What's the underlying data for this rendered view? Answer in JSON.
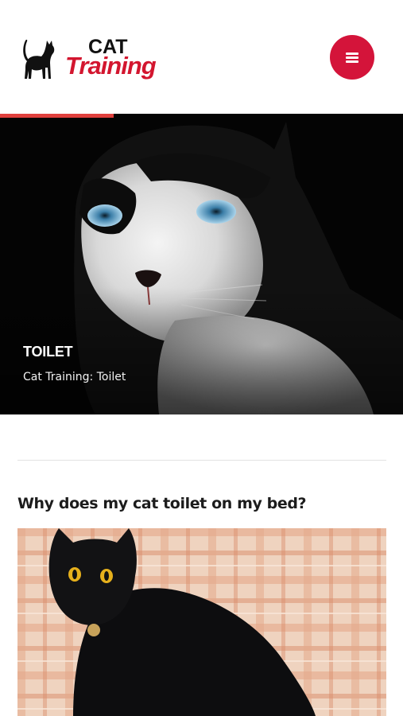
{
  "header": {
    "logo_word_top": "CAT",
    "logo_word_bottom": "Training",
    "menu_icon": "hamburger-menu-icon",
    "brand_color": "#d4143a"
  },
  "hero": {
    "title": "TOILET",
    "subtitle": "Cat Training: Toilet",
    "progress_color": "#e0403d",
    "image": "black-and-white-cat-closeup-photo"
  },
  "article": {
    "title": "Why does my cat toilet on my bed?",
    "image": "black-cat-on-plaid-blanket-photo"
  }
}
